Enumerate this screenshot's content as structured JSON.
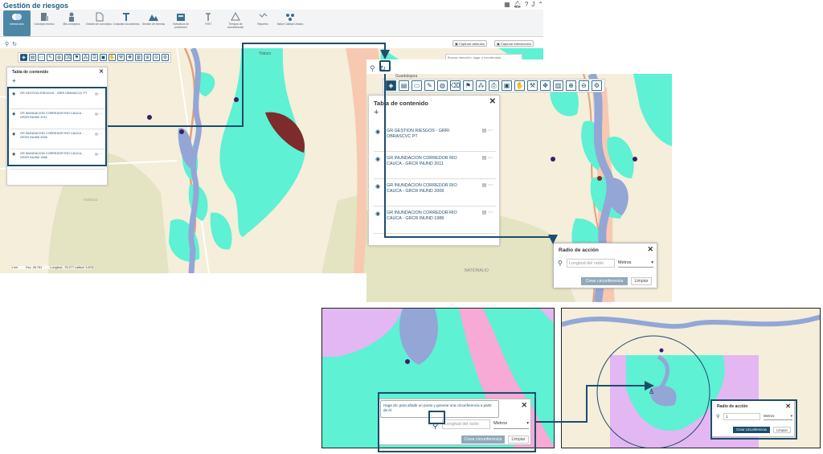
{
  "app": {
    "title": "Gestión de riesgos",
    "user_initial": "J",
    "ribbon": [
      {
        "label": "Intersección",
        "icon": "intersection-icon",
        "active": true
      },
      {
        "label": "Concepto técnico",
        "icon": "technical-concept-icon"
      },
      {
        "label": "Mis conceptos",
        "icon": "my-concepts-icon"
      },
      {
        "label": "Gestión de conceptos",
        "icon": "concept-management-icon"
      },
      {
        "label": "Consultar documentos",
        "icon": "documents-icon"
      },
      {
        "label": "Gestión de eventos",
        "icon": "events-icon"
      },
      {
        "label": "Estructura de protección",
        "icon": "protection-structure-icon"
      },
      {
        "label": "YVET",
        "icon": "yvet-icon"
      },
      {
        "label": "Tiempos de concentración",
        "icon": "concentration-times-icon"
      },
      {
        "label": "Reportes",
        "icon": "reports-icon"
      },
      {
        "label": "Índice Calidad Urbano",
        "icon": "urban-quality-icon"
      }
    ],
    "capture_attr_label": "Capturar atributos",
    "capture_intersection_label": "Capturar intersección",
    "search_placeholder": "Buscar dirección, lugar o coordenada",
    "scalebar": {
      "scale": "1 km",
      "esc": "Esc. 36.751",
      "coords": "Longitud: -76.277 Latitud: 3.876"
    }
  },
  "map_labels": {
    "place_top": "Yotoco",
    "place_left": "YOTOCO",
    "place_right": "GUACARÍ",
    "place_zp": "Guadalajara",
    "place_zp2": "YOTOCO",
    "nationalized": "NATIONALIO"
  },
  "toc": {
    "title": "Tabla de contenido",
    "layers": [
      {
        "name": "GR GESTION RIESGOS - GRRI OBRASCVC PT"
      },
      {
        "name": "GR INUNDACION CORREDOR RIO CAUCA - GRCR INUND 2011"
      },
      {
        "name": "GR INUNDACION CORREDOR RIO CAUCA - GRCR INUND 2008"
      },
      {
        "name": "GR INUNDACION CORREDOR RIO CAUCA - GRCR INUND 1988"
      }
    ]
  },
  "radio": {
    "title": "Radio de acción",
    "placeholder": "Longitud del radio",
    "unit": "Metros",
    "create_label": "Crear circunferencia",
    "clear_label": "Limpiar",
    "tooltip": "Haga clic para añadir un punto y generar una circunferencia a partir de él.",
    "br_value": "1"
  },
  "colors": {
    "flood": "#5ef1d3",
    "river": "#93a6d6",
    "base": "#f4eedb",
    "pink": "#f6aad5",
    "purple": "#e3b7f2",
    "accent": "#1d4d6c"
  }
}
